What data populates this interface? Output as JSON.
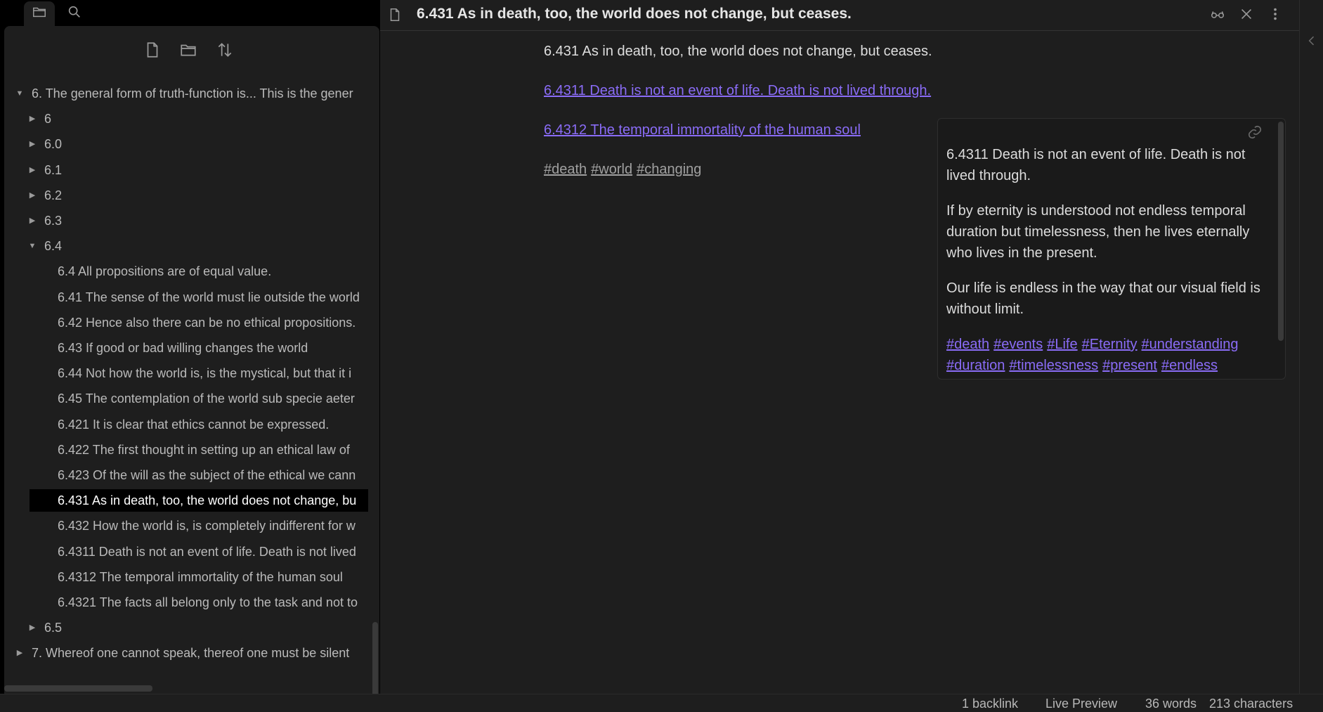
{
  "colors": {
    "accent": "#8a6cf7",
    "background": "#1e1e1e",
    "sidebar_bg": "#000000",
    "active_item_bg": "#000000"
  },
  "sidebar": {
    "tabs": [
      {
        "icon": "folder-icon",
        "active": true
      },
      {
        "icon": "search-icon",
        "active": false
      }
    ],
    "nav_buttons": [
      {
        "icon": "new-note-icon"
      },
      {
        "icon": "new-folder-icon"
      },
      {
        "icon": "sort-icon"
      }
    ],
    "tree": [
      {
        "label": "6. The general form of truth-function is... This is the gener",
        "level": 0,
        "caret": "down"
      },
      {
        "label": "6",
        "level": 1,
        "caret": "right"
      },
      {
        "label": "6.0",
        "level": 1,
        "caret": "right"
      },
      {
        "label": "6.1",
        "level": 1,
        "caret": "right"
      },
      {
        "label": "6.2",
        "level": 1,
        "caret": "right"
      },
      {
        "label": "6.3",
        "level": 1,
        "caret": "right"
      },
      {
        "label": "6.4",
        "level": 1,
        "caret": "down"
      },
      {
        "label": "6.4 All propositions are of equal value.",
        "level": 2
      },
      {
        "label": "6.41 The sense of the world must lie outside the world",
        "level": 2
      },
      {
        "label": "6.42 Hence also there can be no ethical propositions.",
        "level": 2
      },
      {
        "label": "6.43 If good or bad willing changes the world",
        "level": 2
      },
      {
        "label": "6.44 Not how the world is, is the mystical, but that it i",
        "level": 2
      },
      {
        "label": "6.45 The contemplation of the world sub specie aeter",
        "level": 2
      },
      {
        "label": "6.421 It is clear that ethics cannot be expressed.",
        "level": 2
      },
      {
        "label": "6.422 The first thought in setting up an ethical law of",
        "level": 2
      },
      {
        "label": "6.423 Of the will as the subject of the ethical we cann",
        "level": 2
      },
      {
        "label": "6.431 As in death, too, the world does not change, bu",
        "level": 2,
        "active": true
      },
      {
        "label": "6.432 How the world is, is completely indifferent for w",
        "level": 2
      },
      {
        "label": "6.4311 Death is not an event of life. Death is not lived",
        "level": 2
      },
      {
        "label": "6.4312 The temporal immortality of the human soul",
        "level": 2
      },
      {
        "label": "6.4321 The facts all belong only to the task and not to",
        "level": 2
      },
      {
        "label": "6.5",
        "level": 1,
        "caret": "right"
      },
      {
        "label": "7. Whereof one cannot speak, thereof one must be silent",
        "level": 0,
        "caret": "right"
      }
    ]
  },
  "editor": {
    "tab_title": "6.431 As in death, too, the world does not change, but ceases.",
    "heading": "6.431 As in death, too, the world does not change, but ceases.",
    "links": [
      "6.4311 Death is not an event of life. Death is not lived through.",
      "6.4312 The temporal immortality of the human soul"
    ],
    "tags": [
      "#death",
      "#world",
      "#changing"
    ],
    "header_actions": [
      {
        "icon": "reading-view-icon"
      },
      {
        "icon": "close-icon"
      },
      {
        "icon": "more-options-icon"
      }
    ]
  },
  "popover": {
    "paragraphs": [
      "6.4311 Death is not an event of life. Death is not lived through.",
      "If by eternity is understood not endless temporal duration but timelessness, then he lives eternally who lives in the present.",
      "Our life is endless in the way that our visual field is without limit."
    ],
    "tags": [
      "#death",
      "#events",
      "#Life",
      "#Eternity",
      "#understanding",
      "#duration",
      "#timelessness",
      "#present",
      "#endless"
    ]
  },
  "statusbar": {
    "backlinks": "1 backlink",
    "mode": "Live Preview",
    "words": "36 words",
    "characters": "213 characters"
  }
}
